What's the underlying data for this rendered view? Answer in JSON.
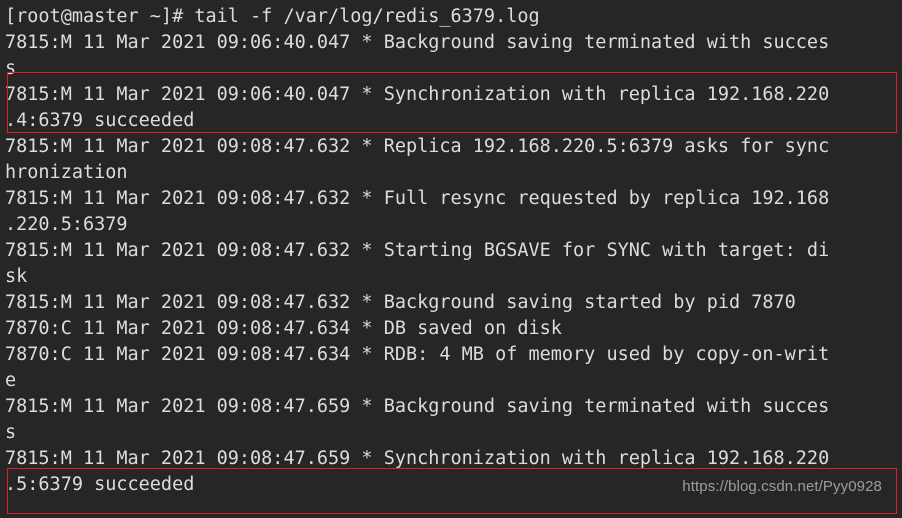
{
  "terminal": {
    "background_color": "#262626",
    "text_color": "#d9dde0",
    "highlight_color": "#e02020",
    "prompt_line": "[root@master ~]# tail -f /var/log/redis_6379.log",
    "command": "tail -f /var/log/redis_6379.log",
    "user": "root",
    "host": "master",
    "cwd": "~",
    "log_file": "/var/log/redis_6379.log",
    "wrap_columns": 73,
    "lines": [
      "[root@master ~]# tail -f /var/log/redis_6379.log",
      "7815:M 11 Mar 2021 09:06:40.047 * Background saving terminated with succes",
      "s",
      "7815:M 11 Mar 2021 09:06:40.047 * Synchronization with replica 192.168.220",
      ".4:6379 succeeded",
      "7815:M 11 Mar 2021 09:08:47.632 * Replica 192.168.220.5:6379 asks for sync",
      "hronization",
      "7815:M 11 Mar 2021 09:08:47.632 * Full resync requested by replica 192.168",
      ".220.5:6379",
      "7815:M 11 Mar 2021 09:08:47.632 * Starting BGSAVE for SYNC with target: di",
      "sk",
      "7815:M 11 Mar 2021 09:08:47.632 * Background saving started by pid 7870",
      "7870:C 11 Mar 2021 09:08:47.634 * DB saved on disk",
      "7870:C 11 Mar 2021 09:08:47.634 * RDB: 4 MB of memory used by copy-on-writ",
      "e",
      "7815:M 11 Mar 2021 09:08:47.659 * Background saving terminated with succes",
      "s",
      "7815:M 11 Mar 2021 09:08:47.659 * Synchronization with replica 192.168.220",
      ".5:6379 succeeded"
    ],
    "highlights": [
      {
        "name": "sync-replica-220-4",
        "text": "7815:M 11 Mar 2021 09:06:40.047 * Synchronization with replica 192.168.220.4:6379 succeeded"
      },
      {
        "name": "sync-replica-220-5",
        "text": "7815:M 11 Mar 2021 09:08:47.659 * Synchronization with replica 192.168.220.5:6379 succeeded"
      }
    ]
  },
  "watermark": {
    "text": "https://blog.csdn.net/Pyy0928"
  }
}
